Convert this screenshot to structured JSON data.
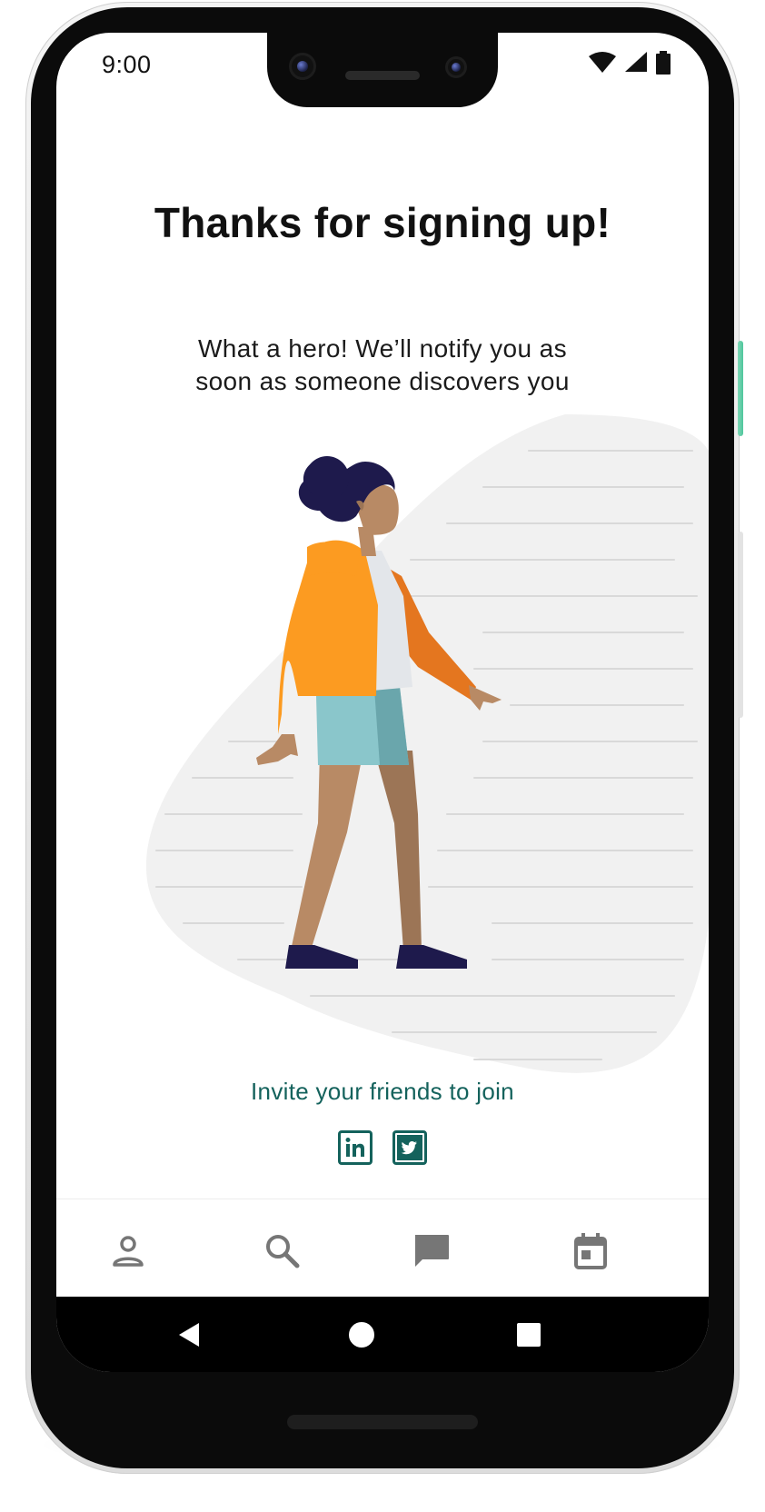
{
  "status_bar": {
    "time": "9:00",
    "icons": [
      "wifi-icon",
      "cellular-signal-icon",
      "battery-icon"
    ]
  },
  "main": {
    "title": "Thanks for signing up!",
    "subtitle_line1": "What a hero! We’ll notify you as",
    "subtitle_line2": "soon as someone discovers you",
    "illustration": "person-walking-illustration",
    "invite_text": "Invite your friends to join",
    "social": [
      {
        "name": "linkedin-icon",
        "label": "in"
      },
      {
        "name": "twitter-icon"
      }
    ]
  },
  "bottom_nav": {
    "items": [
      "profile-icon",
      "search-icon",
      "chat-icon",
      "calendar-icon"
    ]
  },
  "system_nav": {
    "items": [
      "back-icon",
      "home-icon",
      "recents-icon"
    ]
  },
  "colors": {
    "accent": "#14625c",
    "jacket": "#fc9b21",
    "shorts": "#8ac6cb",
    "skin": "#b88a65",
    "hair": "#1e1a4c",
    "background_blob": "#f1f1f1"
  }
}
